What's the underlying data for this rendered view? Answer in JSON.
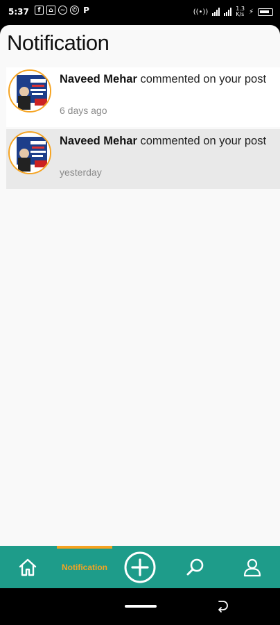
{
  "status_bar": {
    "time": "5:37",
    "app_icons": [
      "facebook-icon",
      "store-icon",
      "messenger-icon",
      "whatsapp-icon",
      "p-app-icon"
    ],
    "p_label": "P",
    "network_speed": "1.3",
    "network_unit": "K/s"
  },
  "header": {
    "title": "Notification"
  },
  "notifications": [
    {
      "name": "Naveed Mehar",
      "action": " commented on your post",
      "time": "6 days ago"
    },
    {
      "name": "Naveed Mehar",
      "action": " commented on your post",
      "time": "yesterday"
    }
  ],
  "bottom_nav": {
    "items": [
      "home-icon",
      "notification",
      "add-icon",
      "search-icon",
      "profile-icon"
    ],
    "notification_label": "Notification",
    "active": "notification"
  },
  "colors": {
    "accent": "#1e9c8a",
    "highlight": "#f5a321",
    "background": "#f9f9f9"
  }
}
